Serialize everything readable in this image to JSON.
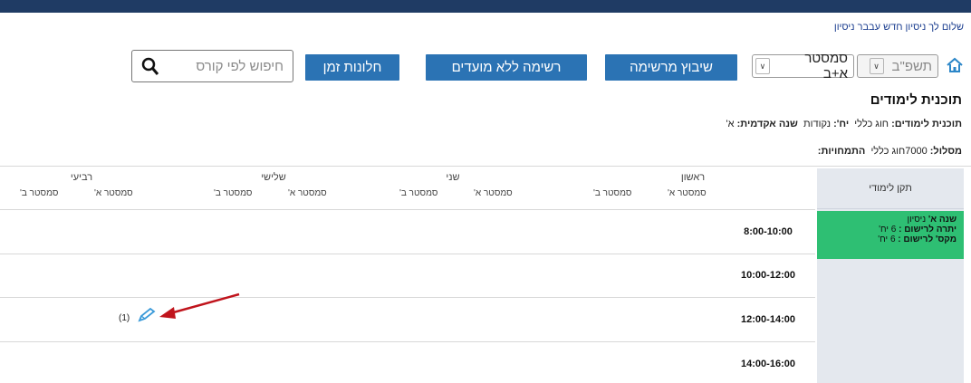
{
  "header": {
    "greeting": "שלום לך ניסיון חדש עבבר ניסיון"
  },
  "toolbar": {
    "year_select": "תשפ\"ב",
    "semester_select": "סמסטר א+ב",
    "placement_button": "שיבוץ מרשימה",
    "list_button": "רשימה ללא מועדים",
    "windows_button": "חלונות זמן",
    "search_placeholder": "חיפוש לפי קורס"
  },
  "program": {
    "title": "תוכנית לימודים",
    "plan_label": "תוכנית לימודים:",
    "plan_value": "חוג כללי",
    "units_label": "יח':",
    "units_value": "נקודות",
    "year_label": "שנה אקדמית:",
    "year_value": "א'",
    "track_label": "מסלול:",
    "track_value": "7000חוג כללי",
    "specialization_label": "התמחויות:"
  },
  "sidebar": {
    "header": "תקן לימודי",
    "quota": {
      "year_label": "שנה א'",
      "year_value": "ניסיון",
      "balance_label": "יתרה לרישום :",
      "balance_value": "6 יח'",
      "max_label": "מקס' לרישום :",
      "max_value": "6 יח'"
    }
  },
  "timetable": {
    "days": [
      {
        "name": "ראשון",
        "sem_a": "סמסטר א'",
        "sem_b": "סמסטר ב'"
      },
      {
        "name": "שני",
        "sem_a": "סמסטר א'",
        "sem_b": "סמסטר ב'"
      },
      {
        "name": "שלישי",
        "sem_a": "סמסטר א'",
        "sem_b": "סמסטר ב'"
      },
      {
        "name": "רביעי",
        "sem_a": "סמסטר א'",
        "sem_b": "סמסטר ב'"
      }
    ],
    "slots": [
      "8:00-10:00",
      "10:00-12:00",
      "12:00-14:00",
      "14:00-16:00"
    ],
    "cell_count": "(1)"
  },
  "colors": {
    "topbar": "#1f3b64",
    "button": "#2b73b4",
    "quota": "#2ebf73",
    "arrow": "#c0141c",
    "pencil": "#3a9ad9"
  }
}
